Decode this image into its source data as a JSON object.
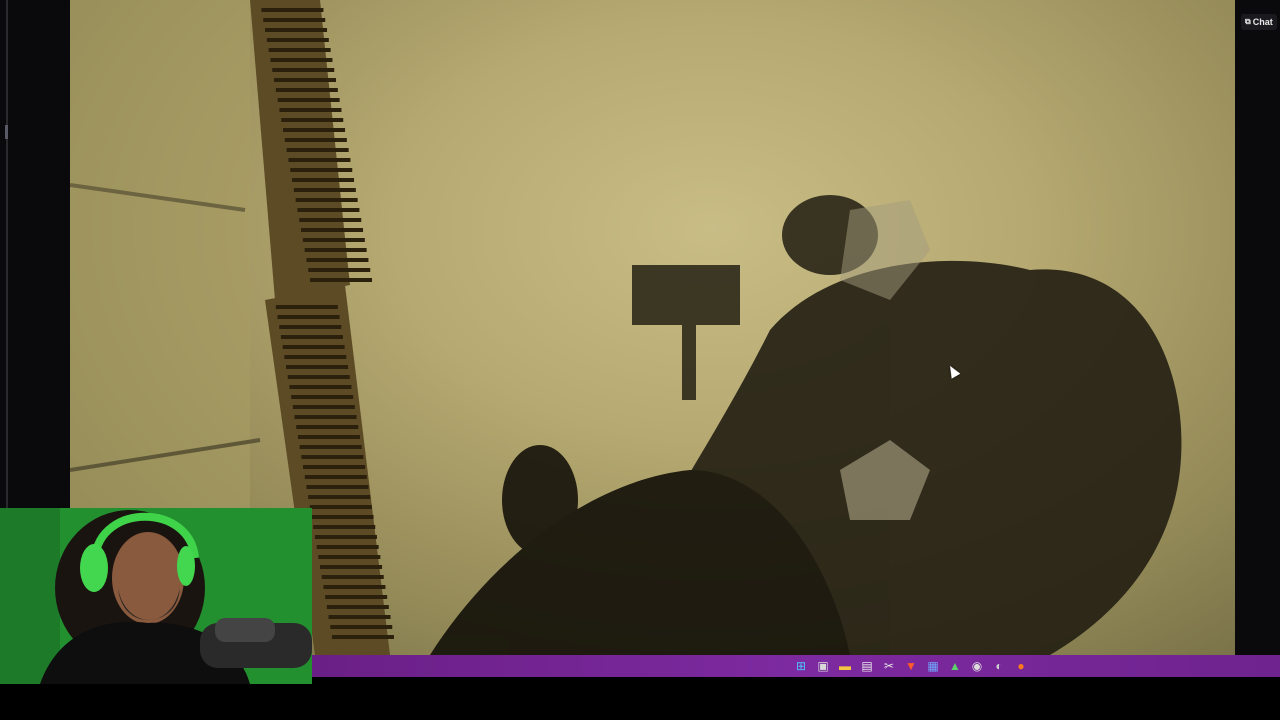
{
  "chat_button": {
    "label": "Chat",
    "icon": "popout-icon"
  },
  "taskbar": {
    "background": "#7d2aa0",
    "icons": [
      {
        "name": "windows-start-icon",
        "glyph": "⊞",
        "color": "#4fc3ff"
      },
      {
        "name": "task-view-icon",
        "glyph": "▣",
        "color": "#d8d8d8"
      },
      {
        "name": "file-explorer-icon",
        "glyph": "▬",
        "color": "#f4c542"
      },
      {
        "name": "notepad-icon",
        "glyph": "▤",
        "color": "#e8e8e8"
      },
      {
        "name": "video-editor-icon",
        "glyph": "✂",
        "color": "#e8e8e8"
      },
      {
        "name": "brave-browser-icon",
        "glyph": "▼",
        "color": "#ff5a2a"
      },
      {
        "name": "document-app-icon",
        "glyph": "▦",
        "color": "#6fa8ff"
      },
      {
        "name": "green-triangle-app-icon",
        "glyph": "▲",
        "color": "#5ad16a"
      },
      {
        "name": "circle-app-icon",
        "glyph": "◉",
        "color": "#dcdcdc"
      },
      {
        "name": "obs-icon",
        "glyph": "◐",
        "color": "#cfcfcf"
      },
      {
        "name": "firefox-icon",
        "glyph": "●",
        "color": "#ff7a1a"
      }
    ]
  }
}
